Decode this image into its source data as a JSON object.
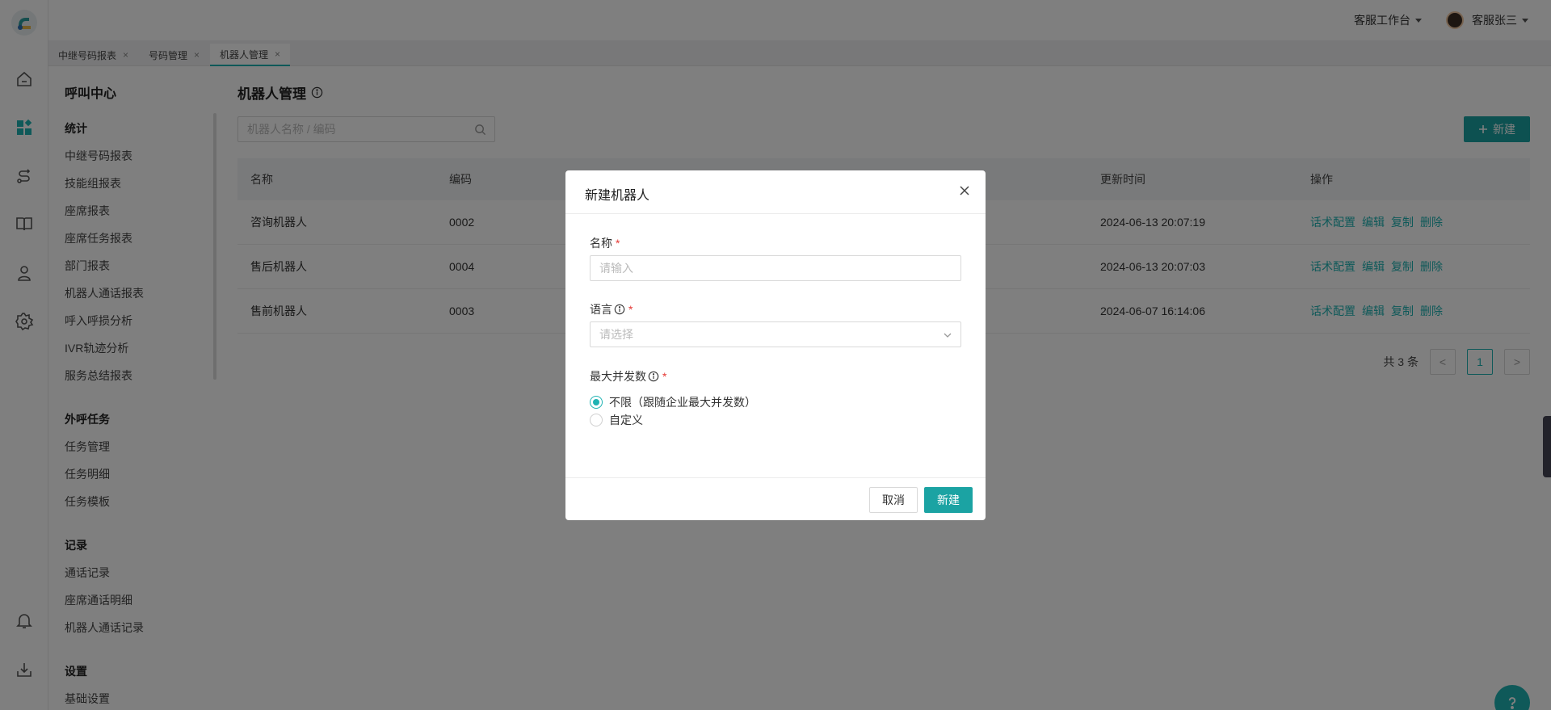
{
  "topbar": {
    "workspace": "客服工作台",
    "username": "客服张三"
  },
  "tabs": [
    {
      "label": "中继号码报表",
      "close": "×"
    },
    {
      "label": "号码管理",
      "close": "×"
    },
    {
      "label": "机器人管理",
      "close": "×"
    }
  ],
  "sidebar": {
    "title": "呼叫中心",
    "groups": [
      {
        "title": "统计",
        "items": [
          "中继号码报表",
          "技能组报表",
          "座席报表",
          "座席任务报表",
          "部门报表",
          "机器人通话报表",
          "呼入呼损分析",
          "IVR轨迹分析",
          "服务总结报表"
        ]
      },
      {
        "title": "外呼任务",
        "items": [
          "任务管理",
          "任务明细",
          "任务模板"
        ]
      },
      {
        "title": "记录",
        "items": [
          "通话记录",
          "座席通话明细",
          "机器人通话记录"
        ]
      },
      {
        "title": "设置",
        "items": [
          "基础设置"
        ]
      }
    ]
  },
  "main": {
    "title": "机器人管理",
    "search_placeholder": "机器人名称 / 编码",
    "new_button": "新建",
    "columns": [
      "名称",
      "编码",
      "更新时间",
      "操作"
    ],
    "rows": [
      {
        "name": "咨询机器人",
        "code": "0002",
        "updated": "2024-06-13 20:07:19"
      },
      {
        "name": "售后机器人",
        "code": "0004",
        "updated": "2024-06-13 20:07:03"
      },
      {
        "name": "售前机器人",
        "code": "0003",
        "updated": "2024-06-07 16:14:06"
      }
    ],
    "row_actions": [
      "话术配置",
      "编辑",
      "复制",
      "删除"
    ],
    "pagination": {
      "total": "共 3 条",
      "prev": "<",
      "current": "1",
      "next": ">"
    }
  },
  "modal": {
    "title": "新建机器人",
    "name_label": "名称",
    "name_placeholder": "请输入",
    "lang_label": "语言",
    "lang_placeholder": "请选择",
    "concurrency_label": "最大并发数",
    "required_mark": "*",
    "options": [
      "不限（跟随企业最大并发数）",
      "自定义"
    ],
    "selected_option": 0,
    "cancel": "取消",
    "confirm": "新建"
  },
  "colors": {
    "accent": "#1fb3b3",
    "button": "#1ba3a3",
    "required": "#e53935",
    "mask": "rgba(0,0,0,0.5)"
  },
  "icons": [
    "home-icon",
    "dashboard-icon",
    "route-icon",
    "book-icon",
    "agent-icon",
    "settings-icon",
    "bell-icon",
    "download-icon",
    "search-icon",
    "info-icon",
    "close-icon",
    "chevron-down-icon",
    "help-icon",
    "plus-icon"
  ]
}
